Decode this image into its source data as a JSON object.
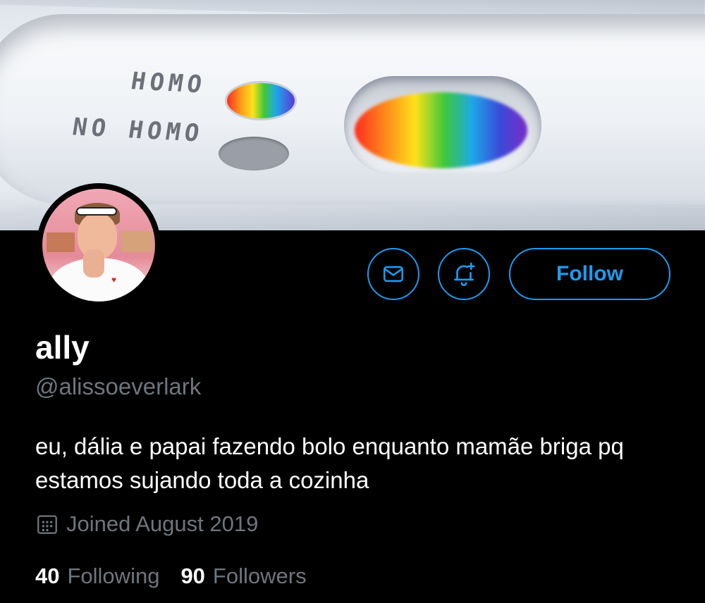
{
  "banner": {
    "label_homo": "HOMO",
    "label_no_homo": "NO HOMO"
  },
  "profile": {
    "display_name": "ally",
    "handle": "@alissoeverlark",
    "bio": "eu, dália e papai fazendo bolo enquanto mamãe briga pq estamos sujando toda a cozinha",
    "joined": "Joined August 2019"
  },
  "actions": {
    "message_icon": "envelope-icon",
    "notify_icon": "bell-plus-icon",
    "follow_label": "Follow"
  },
  "stats": {
    "following_count": "40",
    "following_label": "Following",
    "followers_count": "90",
    "followers_label": "Followers"
  },
  "colors": {
    "background": "#000000",
    "accent": "#1d9bf0",
    "secondary_text": "#6e767d"
  }
}
